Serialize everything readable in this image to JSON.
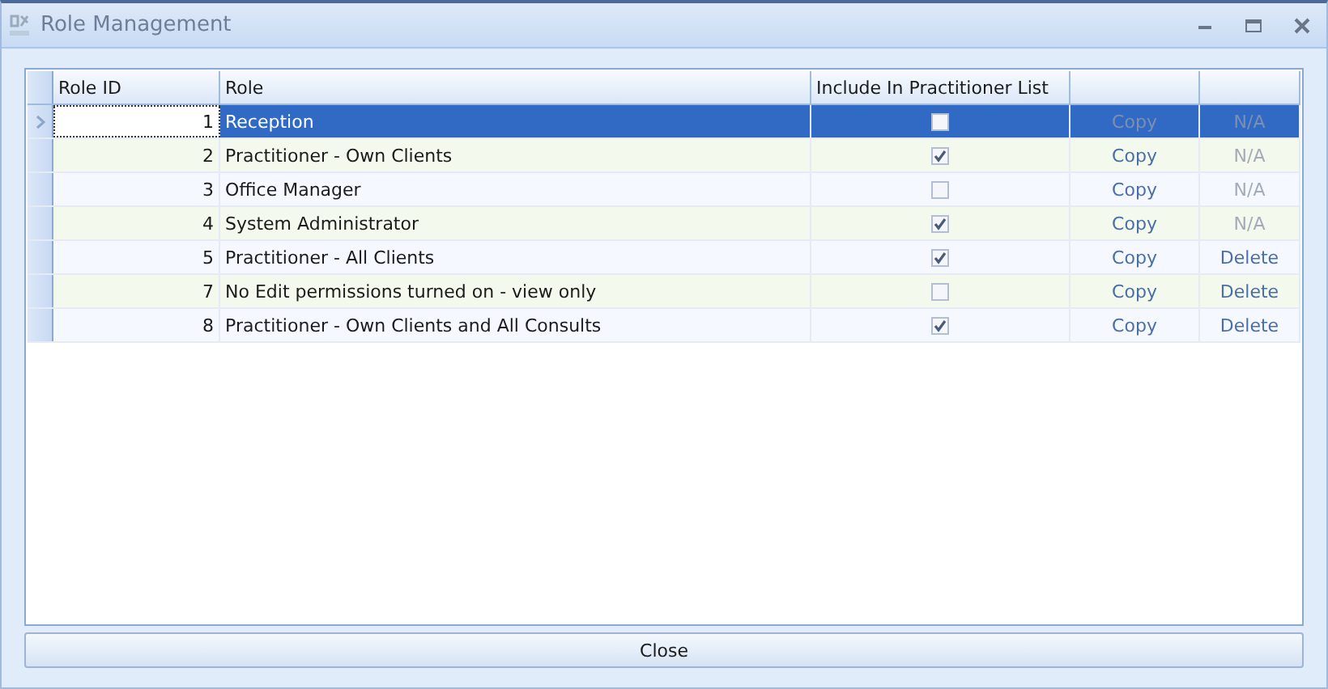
{
  "window": {
    "title": "Role Management"
  },
  "table": {
    "columns": [
      "Role ID",
      "Role",
      "Include In Practitioner List"
    ],
    "rows": [
      {
        "id": "1",
        "role": "Reception",
        "include": false,
        "selected": true,
        "copy": {
          "label": "Copy",
          "disabled": true
        },
        "action": {
          "label": "N/A",
          "disabled": true
        }
      },
      {
        "id": "2",
        "role": "Practitioner - Own Clients",
        "include": true,
        "selected": false,
        "copy": {
          "label": "Copy",
          "disabled": false
        },
        "action": {
          "label": "N/A",
          "disabled": true
        }
      },
      {
        "id": "3",
        "role": "Office Manager",
        "include": false,
        "selected": false,
        "copy": {
          "label": "Copy",
          "disabled": false
        },
        "action": {
          "label": "N/A",
          "disabled": true
        }
      },
      {
        "id": "4",
        "role": "System Administrator",
        "include": true,
        "selected": false,
        "copy": {
          "label": "Copy",
          "disabled": false
        },
        "action": {
          "label": "N/A",
          "disabled": true
        }
      },
      {
        "id": "5",
        "role": "Practitioner - All Clients",
        "include": true,
        "selected": false,
        "copy": {
          "label": "Copy",
          "disabled": false
        },
        "action": {
          "label": "Delete",
          "disabled": false
        }
      },
      {
        "id": "7",
        "role": "No Edit permissions turned on - view only",
        "include": false,
        "selected": false,
        "copy": {
          "label": "Copy",
          "disabled": false
        },
        "action": {
          "label": "Delete",
          "disabled": false
        }
      },
      {
        "id": "8",
        "role": "Practitioner - Own Clients and All Consults",
        "include": true,
        "selected": false,
        "copy": {
          "label": "Copy",
          "disabled": false
        },
        "action": {
          "label": "Delete",
          "disabled": false
        }
      }
    ]
  },
  "buttons": [
    "Close"
  ]
}
